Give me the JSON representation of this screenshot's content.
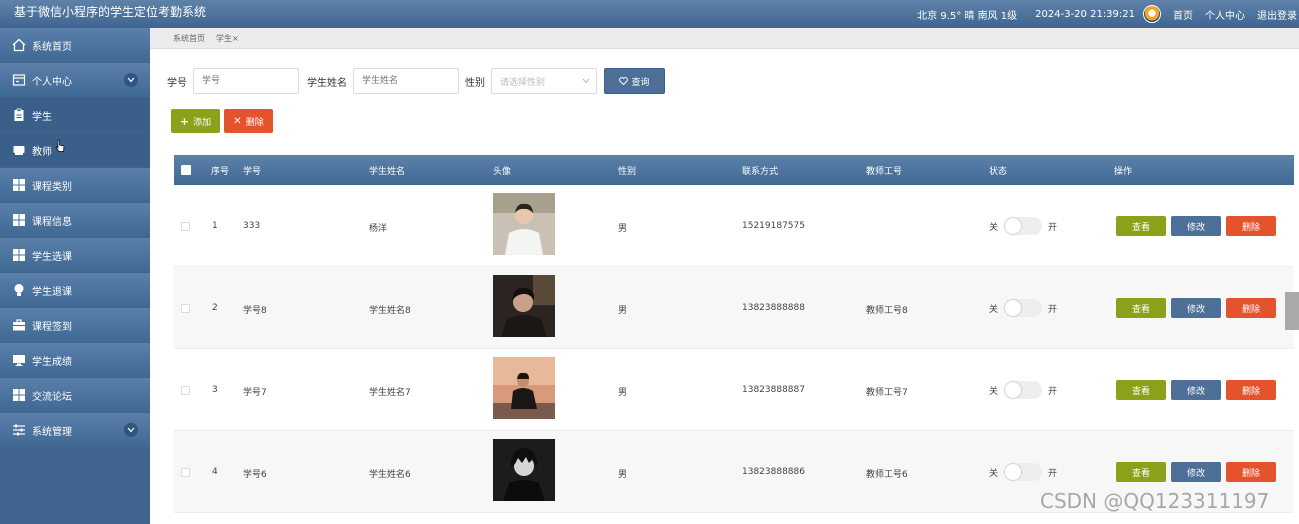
{
  "header": {
    "title": "基于微信小程序的学生定位考勤系统",
    "weather": "北京 9.5° 晴 南风 1级",
    "datetime": "2024-3-20 21:39:21",
    "links": [
      "首页",
      "个人中心",
      "退出登录"
    ]
  },
  "sidebar": {
    "items": [
      {
        "label": "系统首页",
        "icon": "home-icon"
      },
      {
        "label": "个人中心",
        "icon": "profile-icon",
        "expandable": true
      },
      {
        "label": "学生",
        "icon": "clipboard-icon"
      },
      {
        "label": "教师",
        "icon": "tray-icon"
      },
      {
        "label": "课程类别",
        "icon": "grid-icon"
      },
      {
        "label": "课程信息",
        "icon": "grid-icon"
      },
      {
        "label": "学生选课",
        "icon": "grid-icon"
      },
      {
        "label": "学生退课",
        "icon": "bulb-icon"
      },
      {
        "label": "课程签到",
        "icon": "briefcase-icon"
      },
      {
        "label": "学生成绩",
        "icon": "monitor-icon"
      },
      {
        "label": "交流论坛",
        "icon": "grid-icon"
      },
      {
        "label": "系统管理",
        "icon": "sliders-icon",
        "expandable": true
      }
    ]
  },
  "breadcrumb": {
    "home": "系统首页",
    "current": "学生×"
  },
  "search": {
    "student_no_label": "学号",
    "student_no_placeholder": "学号",
    "name_label": "学生姓名",
    "name_placeholder": "学生姓名",
    "gender_label": "性别",
    "gender_placeholder": "请选择性别",
    "query_label": "查询"
  },
  "actions": {
    "add_label": "添加",
    "delete_label": "删除"
  },
  "table": {
    "headers": [
      "序号",
      "学号",
      "学生姓名",
      "头像",
      "性别",
      "联系方式",
      "教师工号",
      "状态",
      "操作"
    ],
    "rows": [
      {
        "index": "1",
        "student_no": "333",
        "name": "杨洋",
        "gender": "男",
        "phone": "15219187575",
        "teacher_no": "",
        "photo": "portrait-white-shirt"
      },
      {
        "index": "2",
        "student_no": "学号8",
        "name": "学生姓名8",
        "gender": "男",
        "phone": "13823888888",
        "teacher_no": "教师工号8",
        "photo": "portrait-dark"
      },
      {
        "index": "3",
        "student_no": "学号7",
        "name": "学生姓名7",
        "gender": "男",
        "phone": "13823888887",
        "teacher_no": "教师工号7",
        "photo": "portrait-sunset"
      },
      {
        "index": "4",
        "student_no": "学号6",
        "name": "学生姓名6",
        "gender": "男",
        "phone": "13823888886",
        "teacher_no": "教师工号6",
        "photo": "portrait-anime"
      }
    ],
    "toggle_off": "关",
    "toggle_on": "开",
    "view_label": "查看",
    "edit_label": "修改",
    "delete_label": "删除"
  },
  "watermark": "CSDN @QQ123311197",
  "colors": {
    "header": "#4a6f98",
    "sidebar": "#3f658f",
    "green": "#8aa219",
    "blue": "#4e6f97",
    "red": "#e5532c"
  }
}
